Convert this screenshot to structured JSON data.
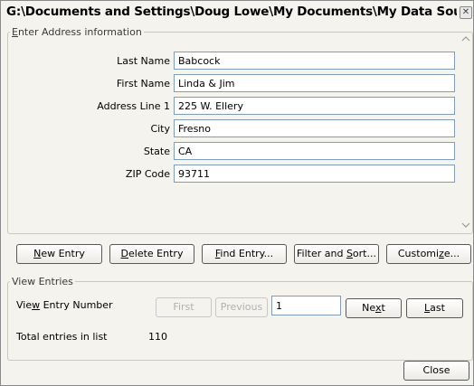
{
  "window": {
    "title": "G:\\Documents and Settings\\Doug Lowe\\My Documents\\My Data Sourc...",
    "close_glyph": "✕"
  },
  "address_group": {
    "legend": "Enter Address information",
    "fields": [
      {
        "label": "Last Name",
        "value": "Babcock"
      },
      {
        "label": "First Name",
        "value": "Linda & Jim"
      },
      {
        "label": "Address Line 1",
        "value": "225 W. Ellery"
      },
      {
        "label": "City",
        "value": "Fresno"
      },
      {
        "label": "State",
        "value": "CA"
      },
      {
        "label": "ZIP Code",
        "value": "93711"
      }
    ]
  },
  "actions": {
    "new_entry": "New Entry",
    "delete_entry": "Delete Entry",
    "find_entry": "Find Entry...",
    "filter_sort": "Filter and Sort...",
    "customize": "Customize..."
  },
  "view_group": {
    "legend": "View Entries",
    "entry_number_label": "View Entry Number",
    "first": "First",
    "previous": "Previous",
    "entry_number_value": "1",
    "next": "Next",
    "last": "Last",
    "total_label": "Total entries in list",
    "total_value": "110"
  },
  "footer": {
    "close": "Close"
  },
  "icons": {
    "scroll_up": "chevron-up-icon",
    "scroll_down": "chevron-down-icon"
  }
}
